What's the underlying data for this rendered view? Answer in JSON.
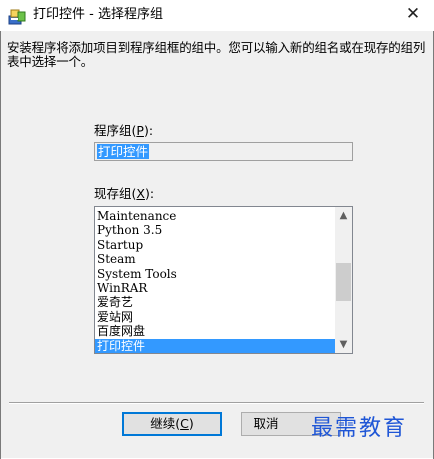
{
  "window": {
    "title": "打印控件 - 选择程序组",
    "close_symbol": "✕"
  },
  "instruction": "安装程序将添加项目到程序组框的组中。您可以输入新的组名或在现存的组列表中选择一个。",
  "program_group": {
    "label_prefix": "程序组(",
    "label_key": "P",
    "label_suffix": "):",
    "value": "打印控件"
  },
  "existing_groups": {
    "label_prefix": "现存组(",
    "label_key": "X",
    "label_suffix": "):",
    "items": [
      "Maintenance",
      "Python 3.5",
      "Startup",
      "Steam",
      "System Tools",
      "WinRAR",
      "爱奇艺",
      "爱站网",
      "百度网盘",
      "打印控件"
    ],
    "selected": "打印控件"
  },
  "buttons": {
    "continue_prefix": "继续(",
    "continue_key": "C",
    "continue_suffix": ")",
    "cancel": "取消"
  },
  "watermark": "最需教育",
  "colors": {
    "selection": "#3399ff",
    "dialog_bg": "#f0f0f0",
    "watermark": "#1f56d6",
    "focus_border": "#0078d7"
  },
  "icons": {
    "app": "installer-icon",
    "close": "close-icon",
    "scroll_up": "chevron-up-icon",
    "scroll_down": "chevron-down-icon"
  }
}
